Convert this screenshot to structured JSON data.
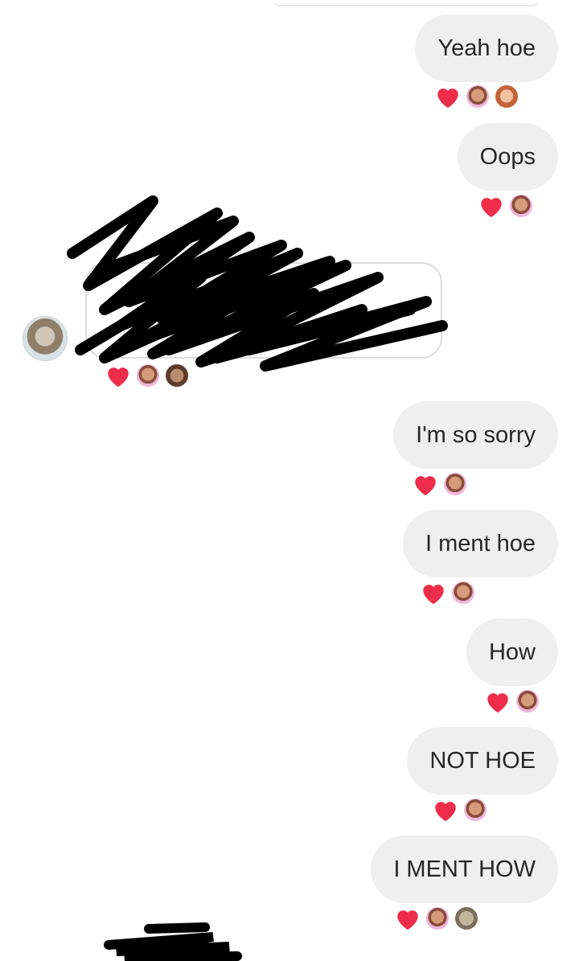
{
  "messages": [
    {
      "text": "Yeah hoe",
      "reactions": [
        "heart-icon",
        "reactor-avatar-1",
        "reactor-avatar-2"
      ]
    },
    {
      "text": "Oops",
      "reactions": [
        "heart-icon",
        "reactor-avatar-1"
      ]
    },
    {
      "text": "I'm so sorry",
      "reactions": [
        "heart-icon",
        "reactor-avatar-1"
      ]
    },
    {
      "text": "I ment hoe",
      "reactions": [
        "heart-icon",
        "reactor-avatar-1"
      ]
    },
    {
      "text": "How",
      "reactions": [
        "heart-icon",
        "reactor-avatar-1"
      ]
    },
    {
      "text": "NOT HOE",
      "reactions": [
        "heart-icon",
        "reactor-avatar-1"
      ]
    },
    {
      "text": "I MENT HOW",
      "reactions": [
        "heart-icon",
        "reactor-avatar-1",
        "reactor-avatar-3"
      ]
    }
  ],
  "shared_post": {
    "reactions": [
      "heart-icon",
      "reactor-avatar-1",
      "reactor-avatar-2"
    ]
  },
  "colors": {
    "bubble": "#efefef",
    "heart": "#ed2d49",
    "text": "#262626"
  }
}
